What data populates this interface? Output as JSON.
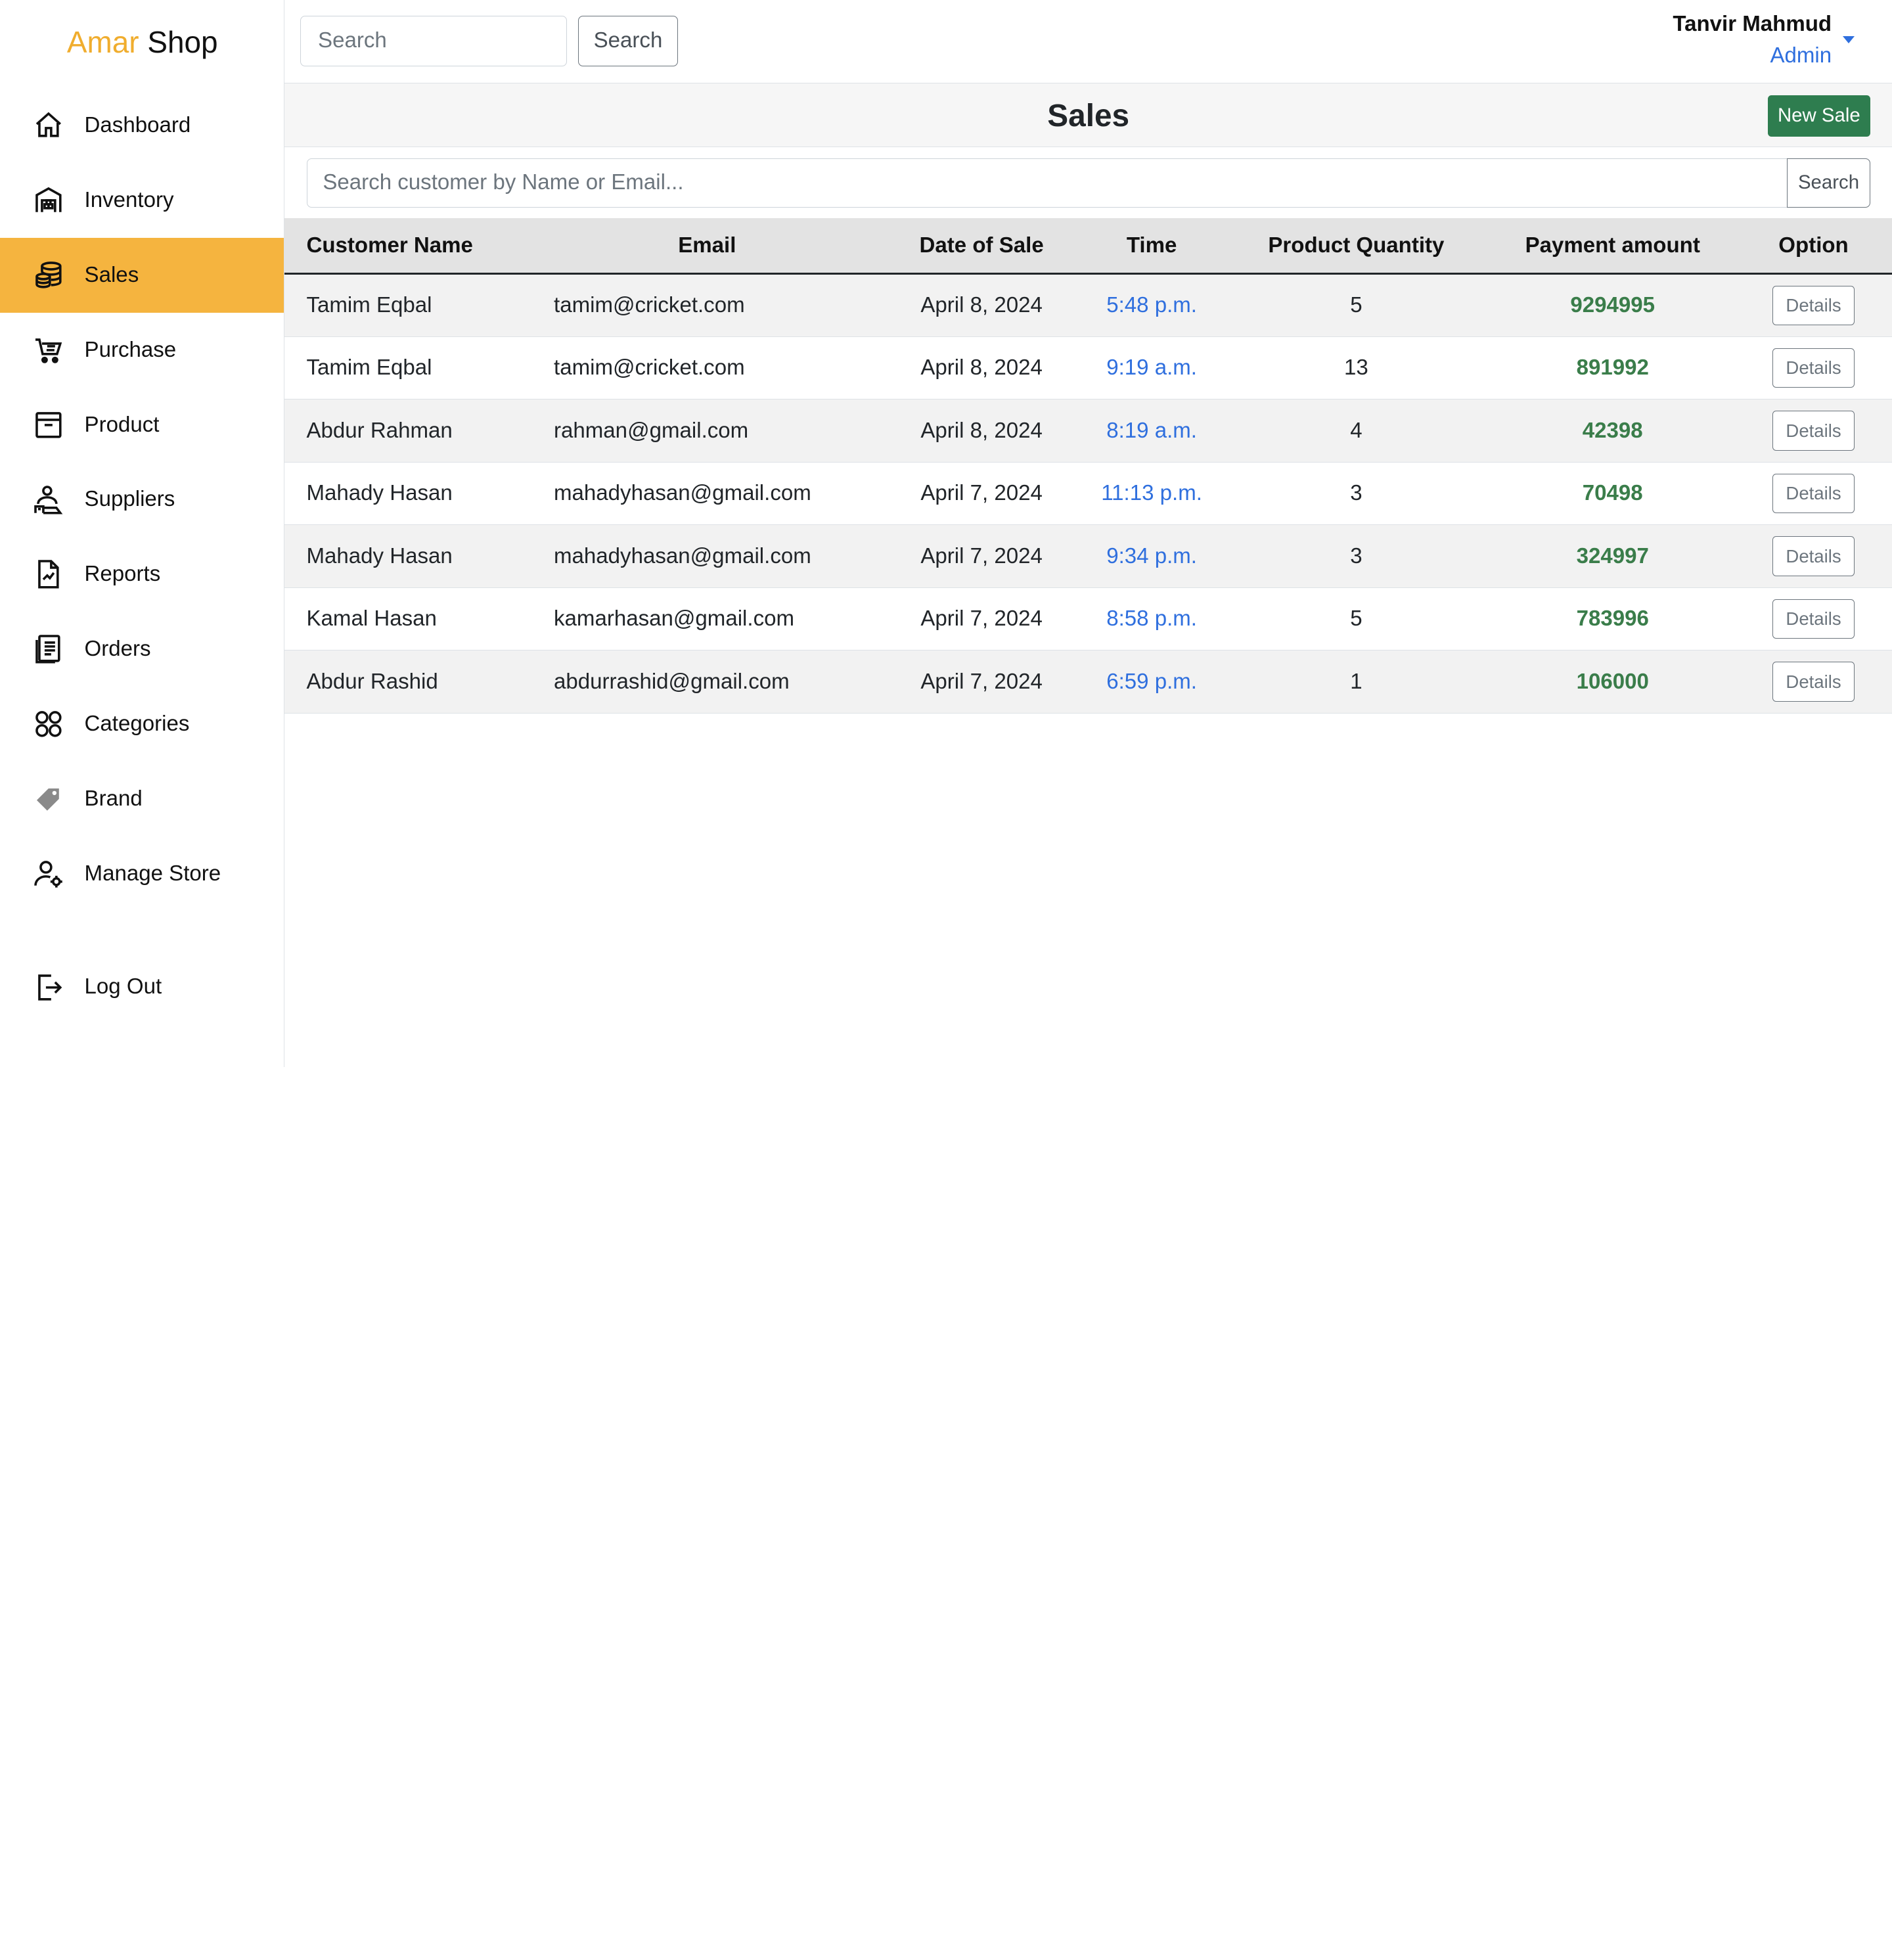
{
  "brand": {
    "part1": "Amar",
    "part2": "Shop"
  },
  "sidebar": {
    "items": [
      {
        "label": "Dashboard",
        "icon": "home-icon"
      },
      {
        "label": "Inventory",
        "icon": "warehouse-icon"
      },
      {
        "label": "Sales",
        "icon": "coins-icon",
        "active": true
      },
      {
        "label": "Purchase",
        "icon": "cart-icon"
      },
      {
        "label": "Product",
        "icon": "archive-icon"
      },
      {
        "label": "Suppliers",
        "icon": "supplier-icon"
      },
      {
        "label": "Reports",
        "icon": "report-icon"
      },
      {
        "label": "Orders",
        "icon": "orders-icon"
      },
      {
        "label": "Categories",
        "icon": "categories-icon"
      },
      {
        "label": "Brand",
        "icon": "tag-icon"
      },
      {
        "label": "Manage Store",
        "icon": "user-gear-icon"
      }
    ],
    "logout_label": "Log Out"
  },
  "topbar": {
    "search_placeholder": "Search",
    "search_button": "Search",
    "user_name": "Tanvir Mahmud",
    "user_role": "Admin"
  },
  "page": {
    "title": "Sales",
    "new_sale_label": "New Sale",
    "customer_search_placeholder": "Search customer by Name or Email...",
    "customer_search_button": "Search"
  },
  "table": {
    "headers": [
      "Customer Name",
      "Email",
      "Date of Sale",
      "Time",
      "Product Quantity",
      "Payment amount",
      "Option"
    ],
    "rows": [
      {
        "name": "Tamim Eqbal",
        "email": "tamim@cricket.com",
        "date": "April 8, 2024",
        "time": "5:48 p.m.",
        "qty": "5",
        "amount": "9294995",
        "option": "Details"
      },
      {
        "name": "Tamim Eqbal",
        "email": "tamim@cricket.com",
        "date": "April 8, 2024",
        "time": "9:19 a.m.",
        "qty": "13",
        "amount": "891992",
        "option": "Details"
      },
      {
        "name": "Abdur Rahman",
        "email": "rahman@gmail.com",
        "date": "April 8, 2024",
        "time": "8:19 a.m.",
        "qty": "4",
        "amount": "42398",
        "option": "Details"
      },
      {
        "name": "Mahady Hasan",
        "email": "mahadyhasan@gmail.com",
        "date": "April 7, 2024",
        "time": "11:13 p.m.",
        "qty": "3",
        "amount": "70498",
        "option": "Details"
      },
      {
        "name": "Mahady Hasan",
        "email": "mahadyhasan@gmail.com",
        "date": "April 7, 2024",
        "time": "9:34 p.m.",
        "qty": "3",
        "amount": "324997",
        "option": "Details"
      },
      {
        "name": "Kamal Hasan",
        "email": "kamarhasan@gmail.com",
        "date": "April 7, 2024",
        "time": "8:58 p.m.",
        "qty": "5",
        "amount": "783996",
        "option": "Details"
      },
      {
        "name": "Abdur Rashid",
        "email": "abdurrashid@gmail.com",
        "date": "April 7, 2024",
        "time": "6:59 p.m.",
        "qty": "1",
        "amount": "106000",
        "option": "Details"
      }
    ]
  },
  "colors": {
    "accent": "#f5b43f",
    "brand_orange": "#f0ad2e",
    "link_blue": "#2f6fde",
    "amount_green": "#3a7d4a",
    "button_green": "#2e7d4f"
  }
}
